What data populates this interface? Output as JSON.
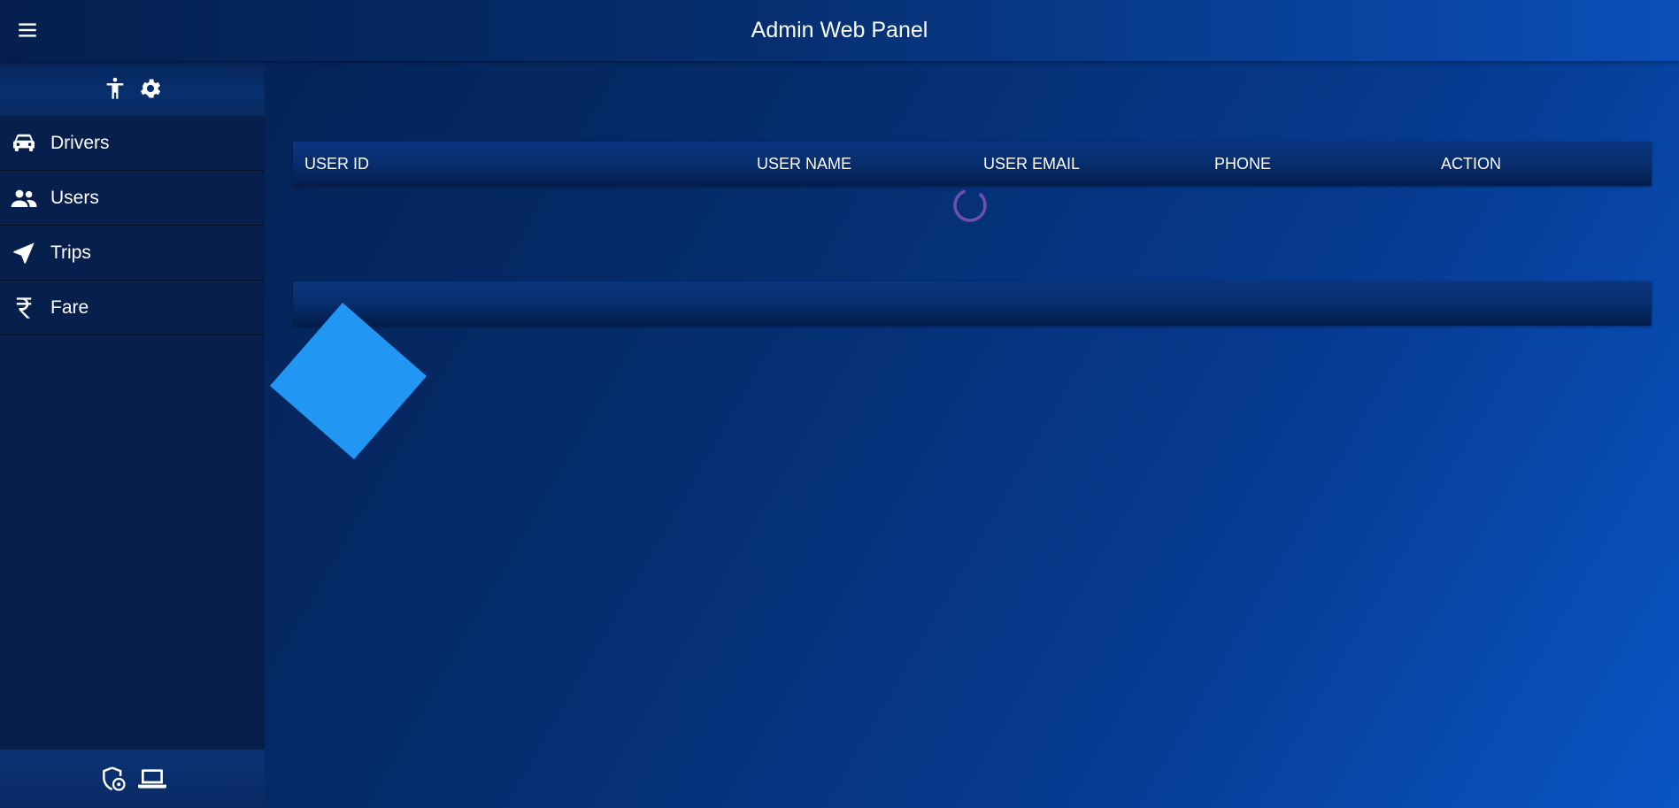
{
  "header": {
    "title": "Admin Web Panel",
    "menu_icon": "hamburger-menu-icon"
  },
  "sidebar": {
    "top_icons": [
      "accessibility-icon",
      "settings-gear-icon"
    ],
    "items": [
      {
        "label": "Drivers",
        "icon": "car-icon"
      },
      {
        "label": "Users",
        "icon": "people-icon"
      },
      {
        "label": "Trips",
        "icon": "navigation-arrow-icon"
      },
      {
        "label": "Fare",
        "icon": "rupee-icon"
      }
    ],
    "bottom_icons": [
      "shield-lock-icon",
      "laptop-icon"
    ]
  },
  "table": {
    "columns": [
      "USER ID",
      "USER NAME",
      "USER EMAIL",
      "PHONE",
      "ACTION"
    ],
    "rows": [],
    "loading": true
  },
  "colors": {
    "background_start": "#041f4e",
    "background_end": "#0a55c4",
    "sidebar": "#061f4c",
    "spinner": "#6f4fb0",
    "diamond": "#2196f3",
    "text": "#ffffff"
  }
}
